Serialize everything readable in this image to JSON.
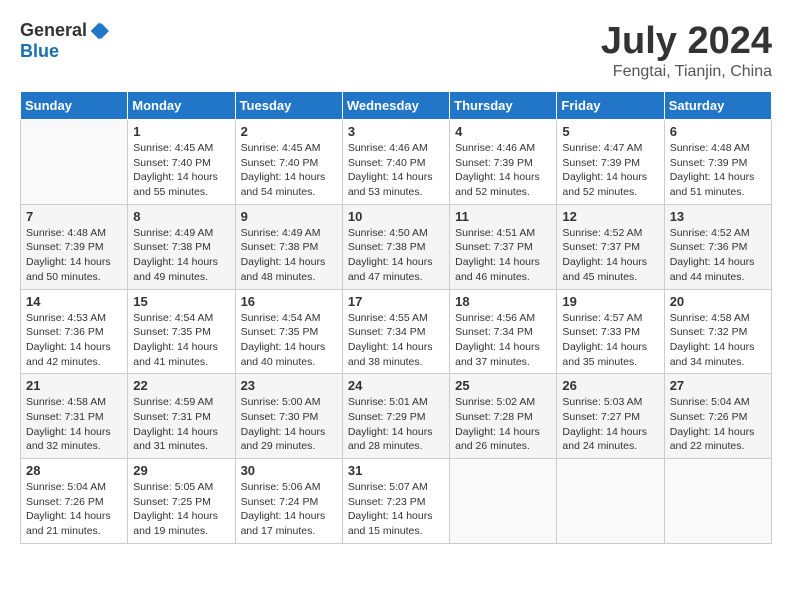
{
  "header": {
    "logo": {
      "general": "General",
      "blue": "Blue"
    },
    "title": "July 2024",
    "location": "Fengtai, Tianjin, China"
  },
  "weekdays": [
    "Sunday",
    "Monday",
    "Tuesday",
    "Wednesday",
    "Thursday",
    "Friday",
    "Saturday"
  ],
  "weeks": [
    [
      {
        "day": "",
        "sunrise": "",
        "sunset": "",
        "daylight": ""
      },
      {
        "day": "1",
        "sunrise": "Sunrise: 4:45 AM",
        "sunset": "Sunset: 7:40 PM",
        "daylight": "Daylight: 14 hours and 55 minutes."
      },
      {
        "day": "2",
        "sunrise": "Sunrise: 4:45 AM",
        "sunset": "Sunset: 7:40 PM",
        "daylight": "Daylight: 14 hours and 54 minutes."
      },
      {
        "day": "3",
        "sunrise": "Sunrise: 4:46 AM",
        "sunset": "Sunset: 7:40 PM",
        "daylight": "Daylight: 14 hours and 53 minutes."
      },
      {
        "day": "4",
        "sunrise": "Sunrise: 4:46 AM",
        "sunset": "Sunset: 7:39 PM",
        "daylight": "Daylight: 14 hours and 52 minutes."
      },
      {
        "day": "5",
        "sunrise": "Sunrise: 4:47 AM",
        "sunset": "Sunset: 7:39 PM",
        "daylight": "Daylight: 14 hours and 52 minutes."
      },
      {
        "day": "6",
        "sunrise": "Sunrise: 4:48 AM",
        "sunset": "Sunset: 7:39 PM",
        "daylight": "Daylight: 14 hours and 51 minutes."
      }
    ],
    [
      {
        "day": "7",
        "sunrise": "Sunrise: 4:48 AM",
        "sunset": "Sunset: 7:39 PM",
        "daylight": "Daylight: 14 hours and 50 minutes."
      },
      {
        "day": "8",
        "sunrise": "Sunrise: 4:49 AM",
        "sunset": "Sunset: 7:38 PM",
        "daylight": "Daylight: 14 hours and 49 minutes."
      },
      {
        "day": "9",
        "sunrise": "Sunrise: 4:49 AM",
        "sunset": "Sunset: 7:38 PM",
        "daylight": "Daylight: 14 hours and 48 minutes."
      },
      {
        "day": "10",
        "sunrise": "Sunrise: 4:50 AM",
        "sunset": "Sunset: 7:38 PM",
        "daylight": "Daylight: 14 hours and 47 minutes."
      },
      {
        "day": "11",
        "sunrise": "Sunrise: 4:51 AM",
        "sunset": "Sunset: 7:37 PM",
        "daylight": "Daylight: 14 hours and 46 minutes."
      },
      {
        "day": "12",
        "sunrise": "Sunrise: 4:52 AM",
        "sunset": "Sunset: 7:37 PM",
        "daylight": "Daylight: 14 hours and 45 minutes."
      },
      {
        "day": "13",
        "sunrise": "Sunrise: 4:52 AM",
        "sunset": "Sunset: 7:36 PM",
        "daylight": "Daylight: 14 hours and 44 minutes."
      }
    ],
    [
      {
        "day": "14",
        "sunrise": "Sunrise: 4:53 AM",
        "sunset": "Sunset: 7:36 PM",
        "daylight": "Daylight: 14 hours and 42 minutes."
      },
      {
        "day": "15",
        "sunrise": "Sunrise: 4:54 AM",
        "sunset": "Sunset: 7:35 PM",
        "daylight": "Daylight: 14 hours and 41 minutes."
      },
      {
        "day": "16",
        "sunrise": "Sunrise: 4:54 AM",
        "sunset": "Sunset: 7:35 PM",
        "daylight": "Daylight: 14 hours and 40 minutes."
      },
      {
        "day": "17",
        "sunrise": "Sunrise: 4:55 AM",
        "sunset": "Sunset: 7:34 PM",
        "daylight": "Daylight: 14 hours and 38 minutes."
      },
      {
        "day": "18",
        "sunrise": "Sunrise: 4:56 AM",
        "sunset": "Sunset: 7:34 PM",
        "daylight": "Daylight: 14 hours and 37 minutes."
      },
      {
        "day": "19",
        "sunrise": "Sunrise: 4:57 AM",
        "sunset": "Sunset: 7:33 PM",
        "daylight": "Daylight: 14 hours and 35 minutes."
      },
      {
        "day": "20",
        "sunrise": "Sunrise: 4:58 AM",
        "sunset": "Sunset: 7:32 PM",
        "daylight": "Daylight: 14 hours and 34 minutes."
      }
    ],
    [
      {
        "day": "21",
        "sunrise": "Sunrise: 4:58 AM",
        "sunset": "Sunset: 7:31 PM",
        "daylight": "Daylight: 14 hours and 32 minutes."
      },
      {
        "day": "22",
        "sunrise": "Sunrise: 4:59 AM",
        "sunset": "Sunset: 7:31 PM",
        "daylight": "Daylight: 14 hours and 31 minutes."
      },
      {
        "day": "23",
        "sunrise": "Sunrise: 5:00 AM",
        "sunset": "Sunset: 7:30 PM",
        "daylight": "Daylight: 14 hours and 29 minutes."
      },
      {
        "day": "24",
        "sunrise": "Sunrise: 5:01 AM",
        "sunset": "Sunset: 7:29 PM",
        "daylight": "Daylight: 14 hours and 28 minutes."
      },
      {
        "day": "25",
        "sunrise": "Sunrise: 5:02 AM",
        "sunset": "Sunset: 7:28 PM",
        "daylight": "Daylight: 14 hours and 26 minutes."
      },
      {
        "day": "26",
        "sunrise": "Sunrise: 5:03 AM",
        "sunset": "Sunset: 7:27 PM",
        "daylight": "Daylight: 14 hours and 24 minutes."
      },
      {
        "day": "27",
        "sunrise": "Sunrise: 5:04 AM",
        "sunset": "Sunset: 7:26 PM",
        "daylight": "Daylight: 14 hours and 22 minutes."
      }
    ],
    [
      {
        "day": "28",
        "sunrise": "Sunrise: 5:04 AM",
        "sunset": "Sunset: 7:26 PM",
        "daylight": "Daylight: 14 hours and 21 minutes."
      },
      {
        "day": "29",
        "sunrise": "Sunrise: 5:05 AM",
        "sunset": "Sunset: 7:25 PM",
        "daylight": "Daylight: 14 hours and 19 minutes."
      },
      {
        "day": "30",
        "sunrise": "Sunrise: 5:06 AM",
        "sunset": "Sunset: 7:24 PM",
        "daylight": "Daylight: 14 hours and 17 minutes."
      },
      {
        "day": "31",
        "sunrise": "Sunrise: 5:07 AM",
        "sunset": "Sunset: 7:23 PM",
        "daylight": "Daylight: 14 hours and 15 minutes."
      },
      {
        "day": "",
        "sunrise": "",
        "sunset": "",
        "daylight": ""
      },
      {
        "day": "",
        "sunrise": "",
        "sunset": "",
        "daylight": ""
      },
      {
        "day": "",
        "sunrise": "",
        "sunset": "",
        "daylight": ""
      }
    ]
  ]
}
